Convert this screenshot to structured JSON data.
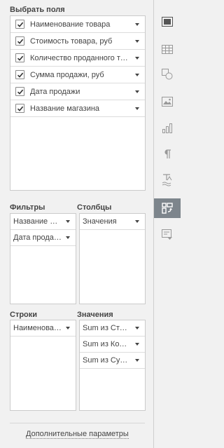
{
  "select_fields": {
    "title": "Выбрать поля",
    "items": [
      {
        "label": "Наименование товара",
        "checked": true
      },
      {
        "label": "Стоимость товара, руб",
        "checked": true
      },
      {
        "label": "Количество проданного товара",
        "checked": true
      },
      {
        "label": "Сумма продажи, руб",
        "checked": true
      },
      {
        "label": "Дата продажи",
        "checked": true
      },
      {
        "label": "Название магазина",
        "checked": true
      }
    ]
  },
  "filters": {
    "title": "Фильтры",
    "items": [
      {
        "label": "Название магазина"
      },
      {
        "label": "Дата продажи"
      }
    ]
  },
  "columns": {
    "title": "Столбцы",
    "items": [
      {
        "label": "Значения"
      }
    ]
  },
  "rows": {
    "title": "Строки",
    "items": [
      {
        "label": "Наименование товара"
      }
    ]
  },
  "values": {
    "title": "Значения",
    "items": [
      {
        "label": "Sum из Стоимость товара, руб"
      },
      {
        "label": "Sum из Количество проданного товара"
      },
      {
        "label": "Sum из Сумма продажи, руб"
      }
    ]
  },
  "footer": {
    "advanced_link": "Дополнительные параметры"
  },
  "sidebar": {
    "items": [
      {
        "icon": "slide-settings-icon",
        "active": false
      },
      {
        "icon": "table-icon",
        "active": false
      },
      {
        "icon": "shape-icon",
        "active": false
      },
      {
        "icon": "image-icon",
        "active": false
      },
      {
        "icon": "chart-icon",
        "active": false
      },
      {
        "icon": "paragraph-icon",
        "active": false
      },
      {
        "icon": "text-art-icon",
        "active": false
      },
      {
        "icon": "pivot-table-icon",
        "active": true
      },
      {
        "icon": "signature-icon",
        "active": false
      }
    ]
  },
  "colors": {
    "accent": "#7d858c",
    "border": "#cbcbcb",
    "panel_bg": "#f1f1f1"
  }
}
